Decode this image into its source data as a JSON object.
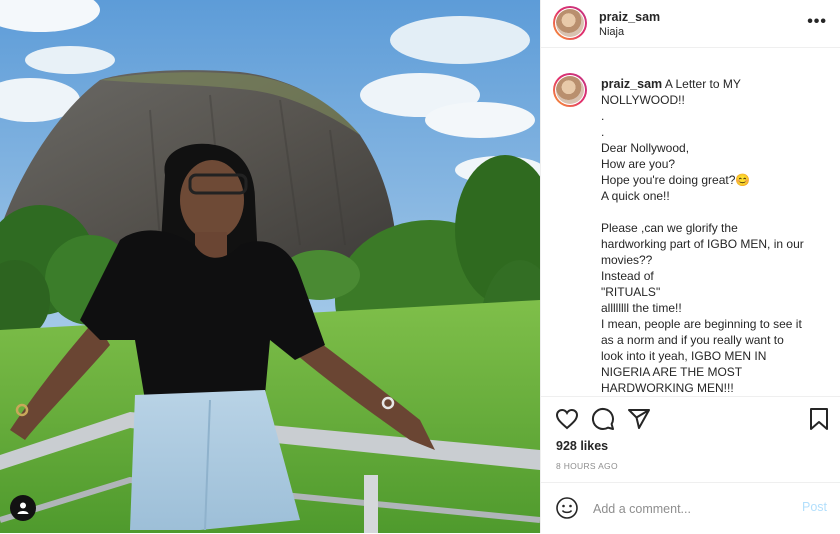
{
  "post": {
    "username": "praiz_sam",
    "location": "Niaja",
    "more_icon": "more-horizontal-icon",
    "caption_lines": [
      "A Letter to MY",
      "NOLLYWOOD!!",
      ".",
      ".",
      "Dear Nollywood,",
      "How are you?",
      "Hope you're doing great?😊",
      "A quick one!!",
      "",
      "Please ,can we glorify the",
      "hardworking part of IGBO MEN, in our",
      "movies??",
      "Instead of",
      "\"RITUALS\"",
      "allllllll the time!!",
      "I mean, people are beginning to see it",
      "as a norm and if you really want to",
      "look into it yeah, IGBO MEN IN",
      "NIGERIA ARE THE MOST",
      "HARDWORKING MEN!!!"
    ],
    "likes": "928 likes",
    "timestamp": "8 HOURS AGO",
    "comment_placeholder": "Add a comment...",
    "post_label": "Post"
  },
  "icons": [
    "heart-icon",
    "comment-icon",
    "share-icon",
    "bookmark-icon",
    "emoji-icon",
    "user-tag-icon"
  ],
  "colors": {
    "post_button": "#b2dffc",
    "secondary_text": "#8e8e8e",
    "avatar_ring": "#e1306c"
  }
}
